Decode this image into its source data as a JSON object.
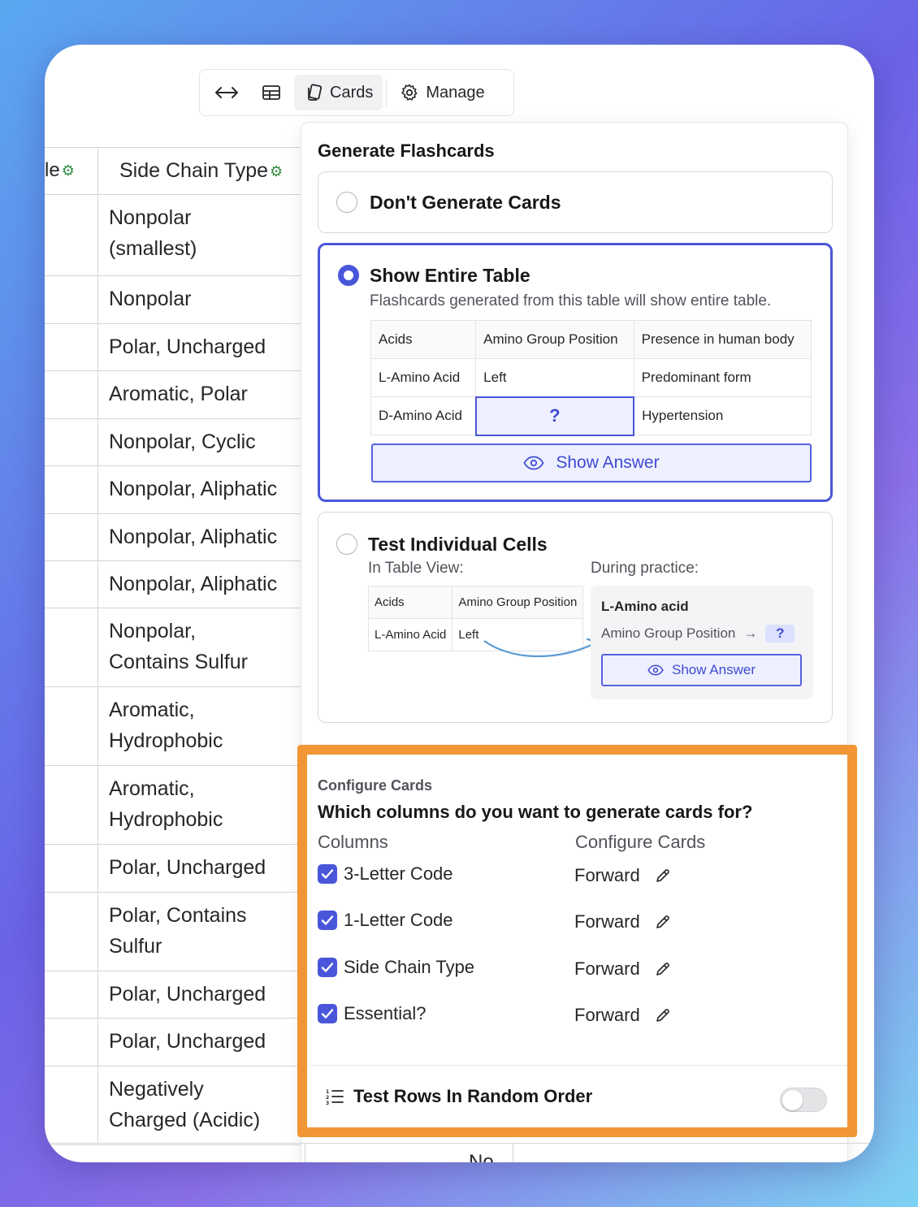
{
  "toolbar": {
    "cards_label": "Cards",
    "manage_label": "Manage"
  },
  "background_table": {
    "header_col1": "le",
    "header_col2": "Side Chain Type",
    "rows": [
      "Nonpolar\n(smallest)",
      "Nonpolar",
      "Polar, Uncharged",
      "Aromatic, Polar",
      "Nonpolar, Cyclic",
      "Nonpolar, Aliphatic",
      "Nonpolar, Aliphatic",
      "Nonpolar, Aliphatic",
      "Nonpolar,\nContains Sulfur",
      "Aromatic,\nHydrophobic",
      "Aromatic,\nHydrophobic",
      "Polar, Uncharged",
      "Polar, Contains\nSulfur",
      "Polar, Uncharged",
      "Polar, Uncharged",
      "Negatively\nCharged (Acidic)"
    ],
    "peek_value": "No"
  },
  "panel": {
    "title": "Generate Flashcards",
    "options": {
      "none": {
        "title": "Don't Generate Cards",
        "selected": false
      },
      "entire": {
        "title": "Show Entire Table",
        "description": "Flashcards generated from this table will show entire table.",
        "selected": true,
        "table": {
          "headers": [
            "Acids",
            "Amino Group Position",
            "Presence in human body"
          ],
          "row1": [
            "L-Amino Acid",
            "Left",
            "Predominant form"
          ],
          "row2": [
            "D-Amino Acid",
            "?",
            "Hypertension"
          ]
        },
        "show_answer": "Show Answer"
      },
      "cells": {
        "title": "Test Individual Cells",
        "selected": false,
        "table_view_label": "In Table View:",
        "practice_label": "During practice:",
        "table": {
          "headers": [
            "Acids",
            "Amino Group Position"
          ],
          "row1": [
            "L-Amino Acid",
            "Left"
          ]
        },
        "practice_title": "L-Amino acid",
        "practice_field": "Amino Group Position",
        "practice_q": "?",
        "show_answer": "Show Answer"
      }
    }
  },
  "configure": {
    "section_label": "Configure Cards",
    "question": "Which columns do you want to generate cards for?",
    "columns_header": "Columns",
    "config_header": "Configure Cards",
    "items": [
      {
        "column": "3-Letter Code",
        "mode": "Forward",
        "checked": true
      },
      {
        "column": "1-Letter Code",
        "mode": "Forward",
        "checked": true
      },
      {
        "column": "Side Chain Type",
        "mode": "Forward",
        "checked": true
      },
      {
        "column": "Essential?",
        "mode": "Forward",
        "checked": true
      }
    ],
    "random_order_label": "Test Rows In Random Order",
    "random_order_on": false
  },
  "colors": {
    "accent": "#4a56d9",
    "highlight": "#f19535"
  }
}
